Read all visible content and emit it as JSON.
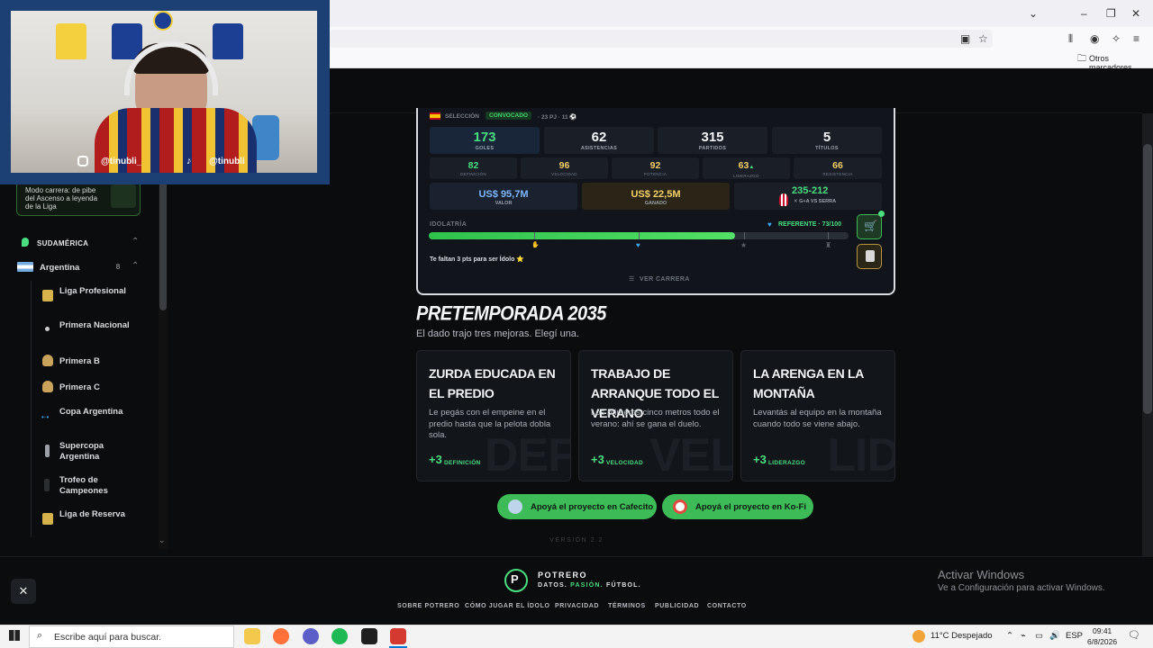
{
  "browser": {
    "other_bookmarks": "Otros marcadores",
    "icons": [
      "minimize-icon",
      "maximize-icon",
      "close-icon",
      "library-icon",
      "account-icon",
      "extensions-icon",
      "menu-icon",
      "bookmark-star-icon",
      "reader-icon",
      "folder-icon"
    ]
  },
  "webcam": {
    "instagram": "@tinubli_",
    "tiktok": "@tinubli"
  },
  "sidebar": {
    "promo_text": "Modo carrera: de pibe del Ascenso a leyenda de la Liga",
    "section": "SUDAMÉRICA",
    "country": "Argentina",
    "country_count": "8",
    "leagues": [
      {
        "label": "Liga Profesional"
      },
      {
        "label": "Primera Nacional"
      },
      {
        "label": "Primera B"
      },
      {
        "label": "Primera C"
      },
      {
        "label": "Copa Argentina"
      },
      {
        "label": "Supercopa Argentina"
      },
      {
        "label": "Trofeo de Campeones"
      },
      {
        "label": "Liga de Reserva"
      }
    ]
  },
  "card": {
    "seleccion": "SELECCIÓN",
    "convocado": "CONVOCADO",
    "caps": "· 23 PJ · 11 ⚽",
    "stats": [
      {
        "value": "173",
        "label": "GOLES",
        "color": "#4ade80"
      },
      {
        "value": "62",
        "label": "ASISTENCIAS",
        "color": "#f1f3f5"
      },
      {
        "value": "315",
        "label": "PARTIDOS",
        "color": "#f1f3f5"
      },
      {
        "value": "5",
        "label": "TÍTULOS",
        "color": "#f1f3f5"
      }
    ],
    "attributes": [
      {
        "value": "82",
        "label": "DEFINICIÓN",
        "color": "#4ade80"
      },
      {
        "value": "96",
        "label": "VELOCIDAD",
        "color": "#f5d06a"
      },
      {
        "value": "92",
        "label": "POTENCIA",
        "color": "#f5d06a"
      },
      {
        "value": "63",
        "label": "LIDERAZGO",
        "color": "#f5d06a"
      },
      {
        "value": "66",
        "label": "RESISTENCIA",
        "color": "#f5d06a"
      }
    ],
    "leadership_arrow": "▲",
    "valor": {
      "value": "US$ 95,7M",
      "label": "VALOR"
    },
    "ganado": {
      "value": "US$ 22,5M",
      "label": "GANADO"
    },
    "rival": {
      "value": "235-212",
      "label": "G+A VS SERRA"
    },
    "idolatria": "IDOLATRÍA",
    "referente": "REFERENTE · 73/100",
    "progress": 0.73,
    "bar_note": "Te faltan 3 pts para ser Ídolo ⭐",
    "ver_carrera": "VER CARRERA"
  },
  "pretemporada": {
    "title": "PRETEMPORADA 2035",
    "subtitle": "El dado trajo tres mejoras. Elegí una.",
    "choices": [
      {
        "title": "ZURDA EDUCADA EN EL PREDIO",
        "desc": "Le pegás con el empeine en el predio hasta que la pelota dobla sola.",
        "plus": "+3",
        "attr": "DEFINICIÓN",
        "bg": "DEF"
      },
      {
        "title": "TRABAJO DE ARRANQUE TODO EL VERANO",
        "desc": "Los primeros cinco metros todo el verano: ahí se gana el duelo.",
        "plus": "+3",
        "attr": "VELOCIDAD",
        "bg": "VEL"
      },
      {
        "title": "LA ARENGA EN LA MONTAÑA",
        "desc": "Levantás al equipo en la montaña cuando todo se viene abajo.",
        "plus": "+3",
        "attr": "LIDERAZGO",
        "bg": "LID"
      }
    ]
  },
  "support": {
    "cafecito": "Apoyá el proyecto en Cafecito",
    "kofi": "Apoyá el proyecto en Ko-Fi"
  },
  "version": "VERSIÓN 2.2",
  "footer": {
    "brand": "POTRERO",
    "tag_a": "DATOS.",
    "tag_b": "PASIÓN.",
    "tag_c": "FÚTBOL.",
    "links": [
      "SOBRE POTRERO",
      "CÓMO JUGAR EL ÍDOLO",
      "PRIVACIDAD",
      "TÉRMINOS",
      "PUBLICIDAD",
      "CONTACTO"
    ],
    "x_label": "✕"
  },
  "windows": {
    "activate_title": "Activar Windows",
    "activate_sub": "Ve a Configuración para activar Windows."
  },
  "taskbar": {
    "search_placeholder": "Escribe aquí para buscar.",
    "weather": "11°C  Despejado",
    "lang": "ESP",
    "time": "09:41",
    "date": "6/8/2026"
  },
  "colors": {
    "accent": "#4ade80",
    "gold": "#f5d06a",
    "blue": "#7eb6ff"
  }
}
